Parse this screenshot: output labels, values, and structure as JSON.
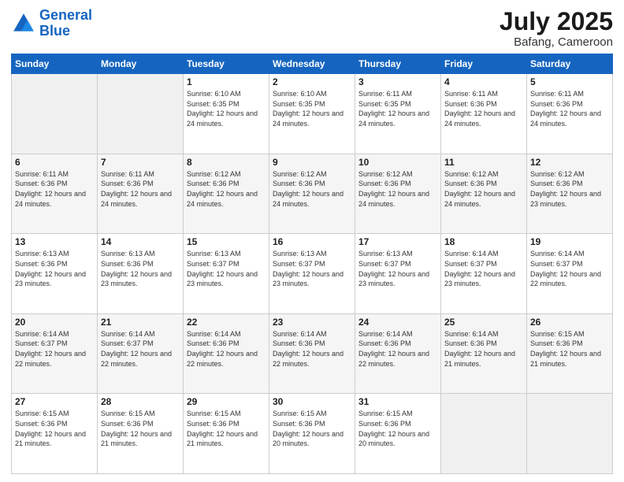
{
  "header": {
    "logo_line1": "General",
    "logo_line2": "Blue",
    "month": "July 2025",
    "location": "Bafang, Cameroon"
  },
  "days_of_week": [
    "Sunday",
    "Monday",
    "Tuesday",
    "Wednesday",
    "Thursday",
    "Friday",
    "Saturday"
  ],
  "weeks": [
    [
      {
        "day": "",
        "info": ""
      },
      {
        "day": "",
        "info": ""
      },
      {
        "day": "1",
        "info": "Sunrise: 6:10 AM\nSunset: 6:35 PM\nDaylight: 12 hours and 24 minutes."
      },
      {
        "day": "2",
        "info": "Sunrise: 6:10 AM\nSunset: 6:35 PM\nDaylight: 12 hours and 24 minutes."
      },
      {
        "day": "3",
        "info": "Sunrise: 6:11 AM\nSunset: 6:35 PM\nDaylight: 12 hours and 24 minutes."
      },
      {
        "day": "4",
        "info": "Sunrise: 6:11 AM\nSunset: 6:36 PM\nDaylight: 12 hours and 24 minutes."
      },
      {
        "day": "5",
        "info": "Sunrise: 6:11 AM\nSunset: 6:36 PM\nDaylight: 12 hours and 24 minutes."
      }
    ],
    [
      {
        "day": "6",
        "info": "Sunrise: 6:11 AM\nSunset: 6:36 PM\nDaylight: 12 hours and 24 minutes."
      },
      {
        "day": "7",
        "info": "Sunrise: 6:11 AM\nSunset: 6:36 PM\nDaylight: 12 hours and 24 minutes."
      },
      {
        "day": "8",
        "info": "Sunrise: 6:12 AM\nSunset: 6:36 PM\nDaylight: 12 hours and 24 minutes."
      },
      {
        "day": "9",
        "info": "Sunrise: 6:12 AM\nSunset: 6:36 PM\nDaylight: 12 hours and 24 minutes."
      },
      {
        "day": "10",
        "info": "Sunrise: 6:12 AM\nSunset: 6:36 PM\nDaylight: 12 hours and 24 minutes."
      },
      {
        "day": "11",
        "info": "Sunrise: 6:12 AM\nSunset: 6:36 PM\nDaylight: 12 hours and 24 minutes."
      },
      {
        "day": "12",
        "info": "Sunrise: 6:12 AM\nSunset: 6:36 PM\nDaylight: 12 hours and 23 minutes."
      }
    ],
    [
      {
        "day": "13",
        "info": "Sunrise: 6:13 AM\nSunset: 6:36 PM\nDaylight: 12 hours and 23 minutes."
      },
      {
        "day": "14",
        "info": "Sunrise: 6:13 AM\nSunset: 6:36 PM\nDaylight: 12 hours and 23 minutes."
      },
      {
        "day": "15",
        "info": "Sunrise: 6:13 AM\nSunset: 6:37 PM\nDaylight: 12 hours and 23 minutes."
      },
      {
        "day": "16",
        "info": "Sunrise: 6:13 AM\nSunset: 6:37 PM\nDaylight: 12 hours and 23 minutes."
      },
      {
        "day": "17",
        "info": "Sunrise: 6:13 AM\nSunset: 6:37 PM\nDaylight: 12 hours and 23 minutes."
      },
      {
        "day": "18",
        "info": "Sunrise: 6:14 AM\nSunset: 6:37 PM\nDaylight: 12 hours and 23 minutes."
      },
      {
        "day": "19",
        "info": "Sunrise: 6:14 AM\nSunset: 6:37 PM\nDaylight: 12 hours and 22 minutes."
      }
    ],
    [
      {
        "day": "20",
        "info": "Sunrise: 6:14 AM\nSunset: 6:37 PM\nDaylight: 12 hours and 22 minutes."
      },
      {
        "day": "21",
        "info": "Sunrise: 6:14 AM\nSunset: 6:37 PM\nDaylight: 12 hours and 22 minutes."
      },
      {
        "day": "22",
        "info": "Sunrise: 6:14 AM\nSunset: 6:36 PM\nDaylight: 12 hours and 22 minutes."
      },
      {
        "day": "23",
        "info": "Sunrise: 6:14 AM\nSunset: 6:36 PM\nDaylight: 12 hours and 22 minutes."
      },
      {
        "day": "24",
        "info": "Sunrise: 6:14 AM\nSunset: 6:36 PM\nDaylight: 12 hours and 22 minutes."
      },
      {
        "day": "25",
        "info": "Sunrise: 6:14 AM\nSunset: 6:36 PM\nDaylight: 12 hours and 21 minutes."
      },
      {
        "day": "26",
        "info": "Sunrise: 6:15 AM\nSunset: 6:36 PM\nDaylight: 12 hours and 21 minutes."
      }
    ],
    [
      {
        "day": "27",
        "info": "Sunrise: 6:15 AM\nSunset: 6:36 PM\nDaylight: 12 hours and 21 minutes."
      },
      {
        "day": "28",
        "info": "Sunrise: 6:15 AM\nSunset: 6:36 PM\nDaylight: 12 hours and 21 minutes."
      },
      {
        "day": "29",
        "info": "Sunrise: 6:15 AM\nSunset: 6:36 PM\nDaylight: 12 hours and 21 minutes."
      },
      {
        "day": "30",
        "info": "Sunrise: 6:15 AM\nSunset: 6:36 PM\nDaylight: 12 hours and 20 minutes."
      },
      {
        "day": "31",
        "info": "Sunrise: 6:15 AM\nSunset: 6:36 PM\nDaylight: 12 hours and 20 minutes."
      },
      {
        "day": "",
        "info": ""
      },
      {
        "day": "",
        "info": ""
      }
    ]
  ]
}
